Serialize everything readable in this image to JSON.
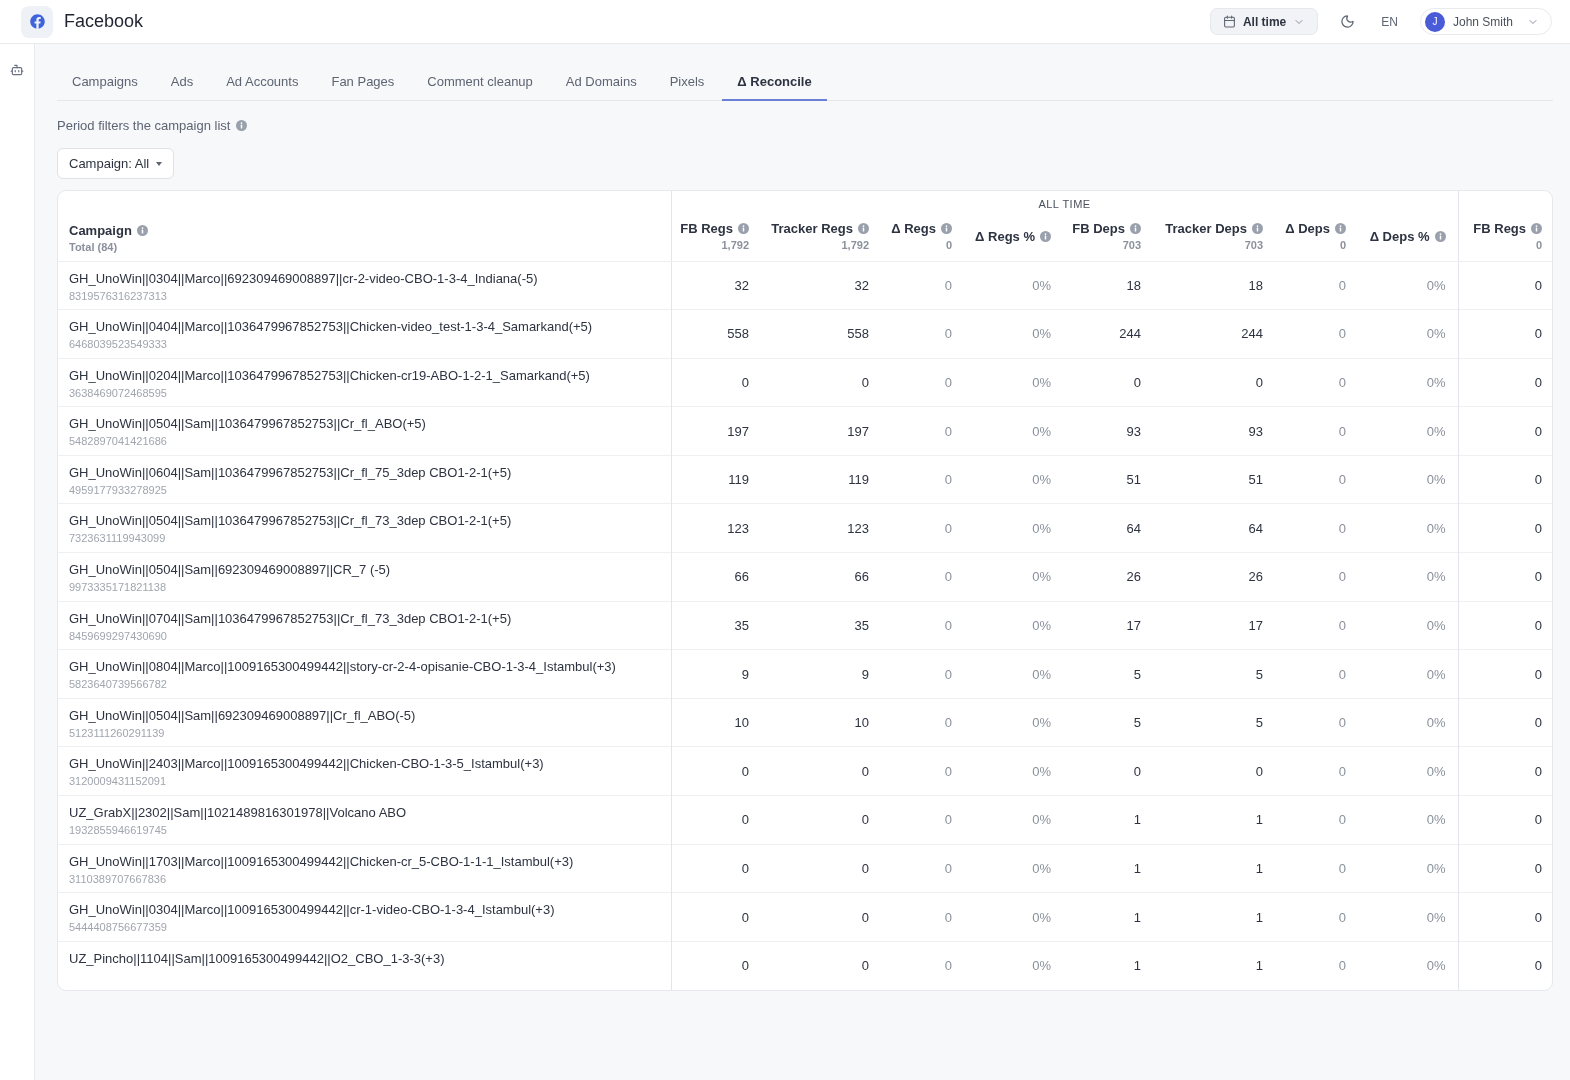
{
  "app": {
    "title": "Facebook"
  },
  "header": {
    "period": "All time",
    "language": "EN",
    "user": {
      "name": "John Smith",
      "initial": "J"
    }
  },
  "tabs": [
    {
      "label": "Campaigns",
      "selected": false
    },
    {
      "label": "Ads",
      "selected": false
    },
    {
      "label": "Ad Accounts",
      "selected": false
    },
    {
      "label": "Fan Pages",
      "selected": false
    },
    {
      "label": "Comment cleanup",
      "selected": false
    },
    {
      "label": "Ad Domains",
      "selected": false
    },
    {
      "label": "Pixels",
      "selected": false
    },
    {
      "label": "Δ Reconcile",
      "selected": true
    }
  ],
  "filter_note": "Period filters the campaign list",
  "campaign_filter": "Campaign: All",
  "table": {
    "campaign_column": {
      "label": "Campaign",
      "total": "Total (84)"
    },
    "groups": [
      {
        "label": "ALL TIME",
        "columns": [
          {
            "label": "FB Regs",
            "total": "1,792",
            "kind": "count"
          },
          {
            "label": "Tracker Regs",
            "total": "1,792",
            "kind": "count"
          },
          {
            "label": "Δ Regs",
            "total": "0",
            "kind": "delta"
          },
          {
            "label": "Δ Regs %",
            "kind": "delta"
          },
          {
            "label": "FB Deps",
            "total": "703",
            "kind": "count"
          },
          {
            "label": "Tracker Deps",
            "total": "703",
            "kind": "count"
          },
          {
            "label": "Δ Deps",
            "total": "0",
            "kind": "delta"
          },
          {
            "label": "Δ Deps %",
            "kind": "delta"
          }
        ]
      },
      {
        "columns": [
          {
            "label": "FB Regs",
            "total": "0",
            "kind": "count"
          }
        ]
      }
    ],
    "rows": [
      {
        "name": "GH_UnoWin||0304||Marco||692309469008897||cr-2-video-CBO-1-3-4_Indiana(-5)",
        "id": "8319576316237313",
        "cells": [
          "32",
          "32",
          "0",
          "0%",
          "18",
          "18",
          "0",
          "0%",
          "0"
        ]
      },
      {
        "name": "GH_UnoWin||0404||Marco||1036479967852753||Chicken-video_test-1-3-4_Samarkand(+5)",
        "id": "6468039523549333",
        "cells": [
          "558",
          "558",
          "0",
          "0%",
          "244",
          "244",
          "0",
          "0%",
          "0"
        ]
      },
      {
        "name": "GH_UnoWin||0204||Marco||1036479967852753||Chicken-cr19-ABO-1-2-1_Samarkand(+5)",
        "id": "3638469072468595",
        "cells": [
          "0",
          "0",
          "0",
          "0%",
          "0",
          "0",
          "0",
          "0%",
          "0"
        ]
      },
      {
        "name": "GH_UnoWin||0504||Sam||1036479967852753||Cr_fl_ABO(+5)",
        "id": "5482897041421686",
        "cells": [
          "197",
          "197",
          "0",
          "0%",
          "93",
          "93",
          "0",
          "0%",
          "0"
        ]
      },
      {
        "name": "GH_UnoWin||0604||Sam||1036479967852753||Cr_fl_75_3dep CBO1-2-1(+5)",
        "id": "4959177933278925",
        "cells": [
          "119",
          "119",
          "0",
          "0%",
          "51",
          "51",
          "0",
          "0%",
          "0"
        ]
      },
      {
        "name": "GH_UnoWin||0504||Sam||1036479967852753||Cr_fl_73_3dep CBO1-2-1(+5)",
        "id": "7323631119943099",
        "cells": [
          "123",
          "123",
          "0",
          "0%",
          "64",
          "64",
          "0",
          "0%",
          "0"
        ]
      },
      {
        "name": "GH_UnoWin||0504||Sam||692309469008897||CR_7 (-5)",
        "id": "9973335171821138",
        "cells": [
          "66",
          "66",
          "0",
          "0%",
          "26",
          "26",
          "0",
          "0%",
          "0"
        ]
      },
      {
        "name": "GH_UnoWin||0704||Sam||1036479967852753||Cr_fl_73_3dep CBO1-2-1(+5)",
        "id": "8459699297430690",
        "cells": [
          "35",
          "35",
          "0",
          "0%",
          "17",
          "17",
          "0",
          "0%",
          "0"
        ]
      },
      {
        "name": "GH_UnoWin||0804||Marco||1009165300499442||story-cr-2-4-opisanie-CBO-1-3-4_Istambul(+3)",
        "id": "5823640739566782",
        "cells": [
          "9",
          "9",
          "0",
          "0%",
          "5",
          "5",
          "0",
          "0%",
          "0"
        ]
      },
      {
        "name": "GH_UnoWin||0504||Sam||692309469008897||Cr_fl_ABO(-5)",
        "id": "5123111260291139",
        "cells": [
          "10",
          "10",
          "0",
          "0%",
          "5",
          "5",
          "0",
          "0%",
          "0"
        ]
      },
      {
        "name": "GH_UnoWin||2403||Marco||1009165300499442||Chicken-CBO-1-3-5_Istambul(+3)",
        "id": "3120009431152091",
        "cells": [
          "0",
          "0",
          "0",
          "0%",
          "0",
          "0",
          "0",
          "0%",
          "0"
        ]
      },
      {
        "name": "UZ_GrabX||2302||Sam||1021489816301978||Volcano ABO",
        "id": "1932855946619745",
        "cells": [
          "0",
          "0",
          "0",
          "0%",
          "1",
          "1",
          "0",
          "0%",
          "0"
        ]
      },
      {
        "name": "GH_UnoWin||1703||Marco||1009165300499442||Chicken-cr_5-CBO-1-1-1_Istambul(+3)",
        "id": "3110389707667836",
        "cells": [
          "0",
          "0",
          "0",
          "0%",
          "1",
          "1",
          "0",
          "0%",
          "0"
        ]
      },
      {
        "name": "GH_UnoWin||0304||Marco||1009165300499442||cr-1-video-CBO-1-3-4_Istambul(+3)",
        "id": "5444408756677359",
        "cells": [
          "0",
          "0",
          "0",
          "0%",
          "1",
          "1",
          "0",
          "0%",
          "0"
        ]
      },
      {
        "name": "UZ_Pincho||1104||Sam||1009165300499442||O2_CBO_1-3-3(+3)",
        "cells": [
          "0",
          "0",
          "0",
          "0%",
          "1",
          "1",
          "0",
          "0%",
          "0"
        ]
      }
    ]
  }
}
